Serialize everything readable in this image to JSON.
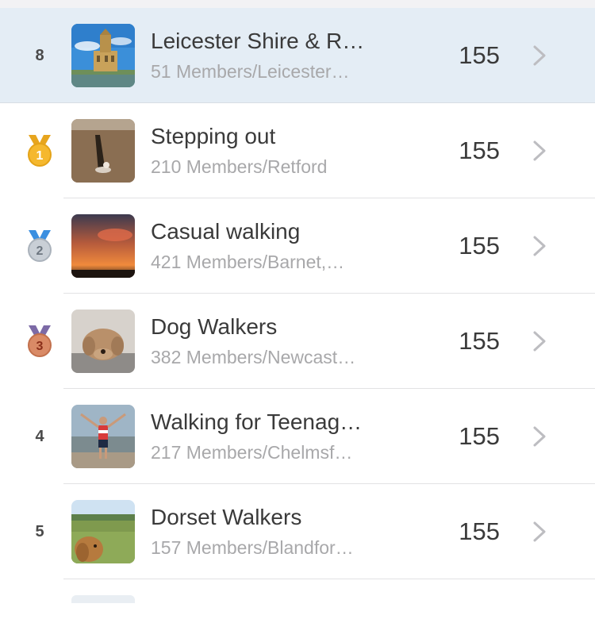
{
  "colors": {
    "highlight_bg": "#e4edf5",
    "gold": "#f5b82e",
    "silver": "#c9cfd6",
    "bronze": "#d98a66"
  },
  "rows": [
    {
      "rank": "8",
      "medal": null,
      "name": "Leicester Shire & R…",
      "sub": "51 Members/Leicester…",
      "score": "155",
      "image": "building-sky"
    },
    {
      "rank": "1",
      "medal": "gold",
      "name": "Stepping out",
      "sub": "210 Members/Retford",
      "score": "155",
      "image": "beach-shadow"
    },
    {
      "rank": "2",
      "medal": "silver",
      "name": "Casual walking",
      "sub": "421 Members/Barnet,…",
      "score": "155",
      "image": "sunset"
    },
    {
      "rank": "3",
      "medal": "bronze",
      "name": "Dog Walkers",
      "sub": "382 Members/Newcast…",
      "score": "155",
      "image": "dog-resting"
    },
    {
      "rank": "4",
      "medal": null,
      "name": "Walking for Teenag…",
      "sub": "217 Members/Chelmsf…",
      "score": "155",
      "image": "person-beach"
    },
    {
      "rank": "5",
      "medal": null,
      "name": "Dorset Walkers",
      "sub": "157 Members/Blandfor…",
      "score": "155",
      "image": "dog-field"
    }
  ]
}
